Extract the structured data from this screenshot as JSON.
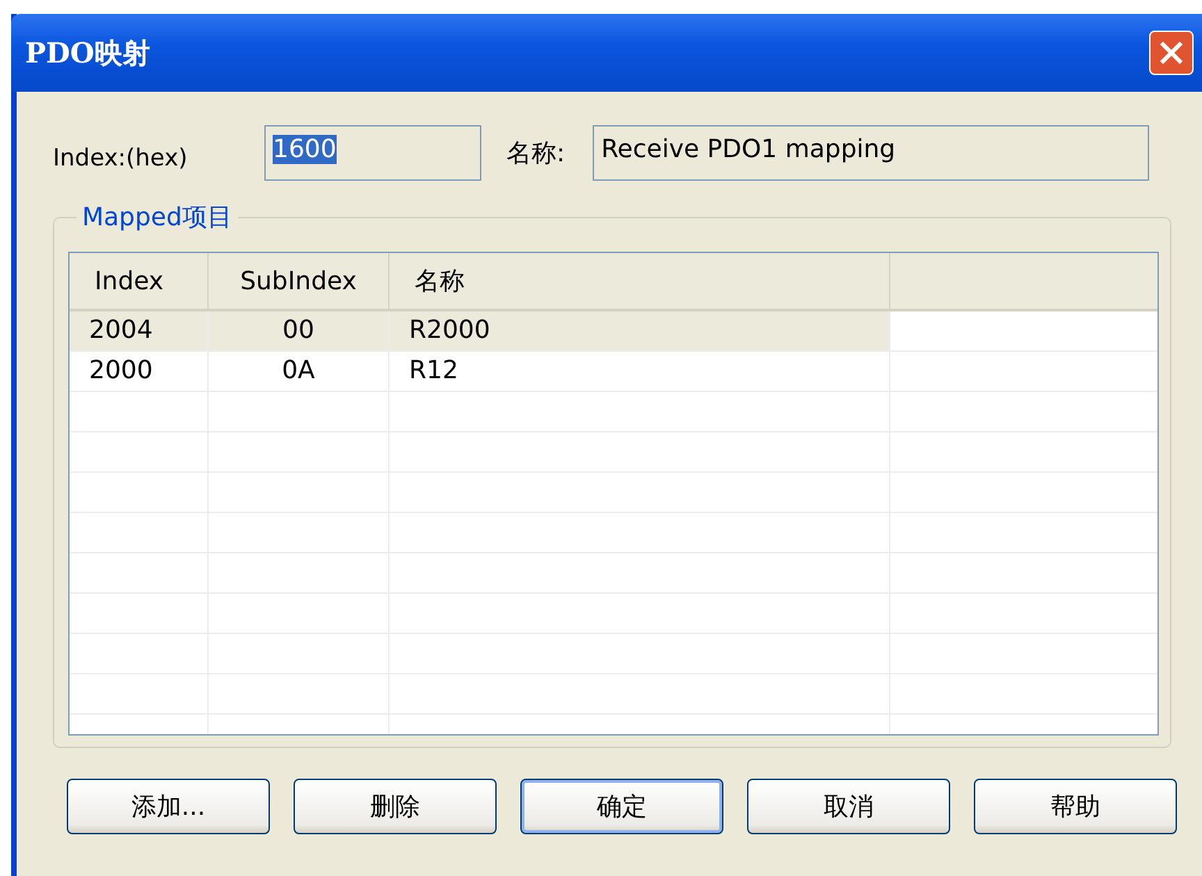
{
  "window": {
    "title": "PDO映射"
  },
  "index_field": {
    "label": "Index:(hex)",
    "value": "1600"
  },
  "name_field": {
    "label": "名称:",
    "value": "Receive PDO1 mapping"
  },
  "group": {
    "title": "Mapped项目"
  },
  "table": {
    "columns": [
      "Index",
      "SubIndex",
      "名称"
    ],
    "rows": [
      {
        "cells": [
          "2004",
          "00",
          "R2000"
        ],
        "selected": true
      },
      {
        "cells": [
          "2000",
          "0A",
          "R12"
        ],
        "selected": false
      }
    ]
  },
  "buttons": [
    {
      "label": "添加...",
      "default": false
    },
    {
      "label": "删除",
      "default": false
    },
    {
      "label": "确定",
      "default": true
    },
    {
      "label": "取消",
      "default": false
    },
    {
      "label": "帮助",
      "default": false
    }
  ]
}
